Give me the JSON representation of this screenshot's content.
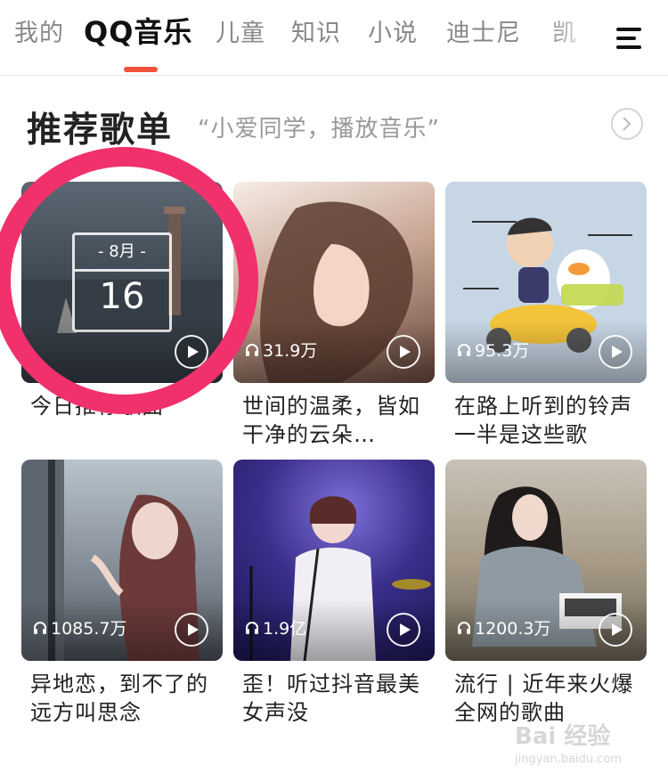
{
  "tabs": [
    {
      "label": "我的"
    },
    {
      "label": "QQ音乐"
    },
    {
      "label": "儿童"
    },
    {
      "label": "知识"
    },
    {
      "label": "小说"
    },
    {
      "label": "迪士尼"
    },
    {
      "label": "凯"
    }
  ],
  "active_tab": "QQ音乐",
  "accent_color": "#f0533b",
  "section": {
    "title": "推荐歌单",
    "subtitle": "“小爱同学，播放音乐”"
  },
  "cards": [
    {
      "title": "今日推荐歌曲",
      "plays": "",
      "calendar": {
        "month": "- 8月 -",
        "day": "16"
      }
    },
    {
      "title": "世间的温柔，皆如干净的云朵…",
      "plays": "31.9万"
    },
    {
      "title": "在路上听到的铃声一半是这些歌",
      "plays": "95.3万"
    },
    {
      "title": "异地恋，到不了的远方叫思念",
      "plays": "1085.7万"
    },
    {
      "title": "歪！听过抖音最美女声没",
      "plays": "1.9亿"
    },
    {
      "title": "流行 | 近年来火爆全网的歌曲",
      "plays": "1200.3万"
    }
  ],
  "annotation_color": "#f0316c",
  "watermark": {
    "brand": "Bai 经验",
    "url": "jingyan.baidu.com"
  }
}
